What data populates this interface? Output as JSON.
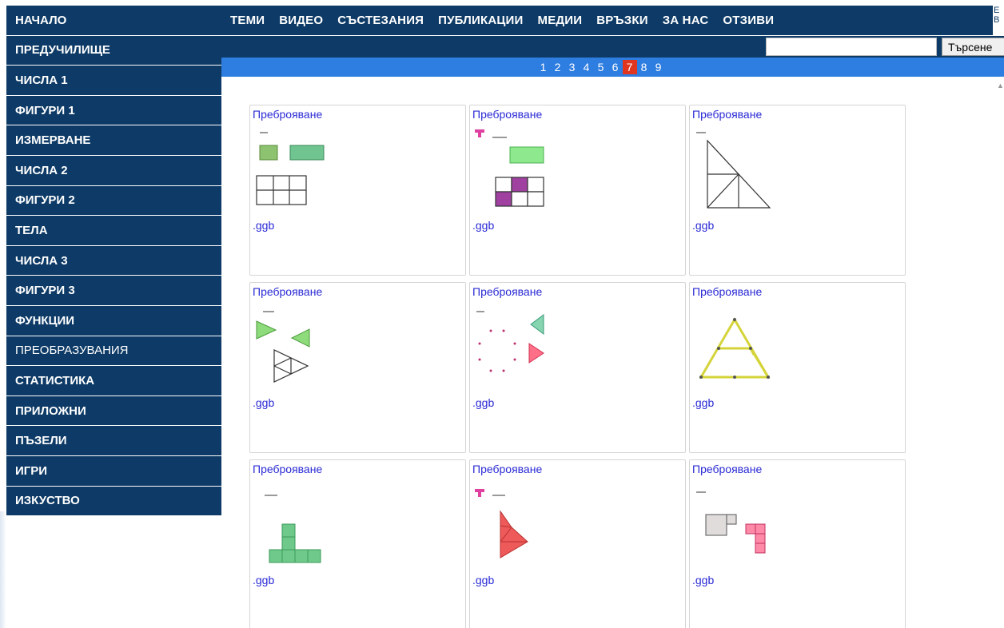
{
  "sidebar": {
    "items": [
      "НАЧАЛО",
      "ПРЕДУЧИЛИЩЕ",
      "ЧИСЛА 1",
      "ФИГУРИ 1",
      "ИЗМЕРВАНЕ",
      "ЧИСЛА 2",
      "ФИГУРИ 2",
      "ТЕЛА",
      "ЧИСЛА 3",
      "ФИГУРИ 3",
      "ФУНКЦИИ",
      "ПРЕОБРАЗУВАНИЯ",
      "СТАТИСТИКА",
      "ПРИЛОЖНИ",
      "ПЪЗЕЛИ",
      "ИГРИ",
      "ИЗКУСТВО"
    ]
  },
  "topnav": {
    "items": [
      "ТЕМИ",
      "ВИДЕО",
      "СЪСТЕЗАНИЯ",
      "ПУБЛИКАЦИИ",
      "МЕДИИ",
      "ВРЪЗКИ",
      "ЗА НАС",
      "ОТЗИВИ"
    ],
    "lang_top": "E",
    "lang_bottom": "B"
  },
  "search": {
    "value": "",
    "button_label": "Търсене"
  },
  "pager": {
    "pages": [
      "1",
      "2",
      "3",
      "4",
      "5",
      "6",
      "7",
      "8",
      "9"
    ],
    "current": "7"
  },
  "cards": [
    {
      "title": "Преброяване",
      "file": ".ggb",
      "thumb": "rectangles-grid"
    },
    {
      "title": "Преброяване",
      "file": ".ggb",
      "thumb": "rect-purple-grid"
    },
    {
      "title": "Преброяване",
      "file": ".ggb",
      "thumb": "triangle-split"
    },
    {
      "title": "Преброяване",
      "file": ".ggb",
      "thumb": "green-triangles"
    },
    {
      "title": "Преброяване",
      "file": ".ggb",
      "thumb": "dots-triangles"
    },
    {
      "title": "Преброяване",
      "file": ".ggb",
      "thumb": "yellow-trapezoid"
    },
    {
      "title": "Преброяване",
      "file": ".ggb",
      "thumb": "green-blocks"
    },
    {
      "title": "Преброяване",
      "file": ".ggb",
      "thumb": "red-triangles"
    },
    {
      "title": "Преброяване",
      "file": ".ggb",
      "thumb": "gray-pink-blocks"
    }
  ],
  "colors": {
    "nav": "#0d3a66",
    "pager": "#2e7de0",
    "active_page": "#e0361f",
    "link": "#2a2ad6"
  }
}
